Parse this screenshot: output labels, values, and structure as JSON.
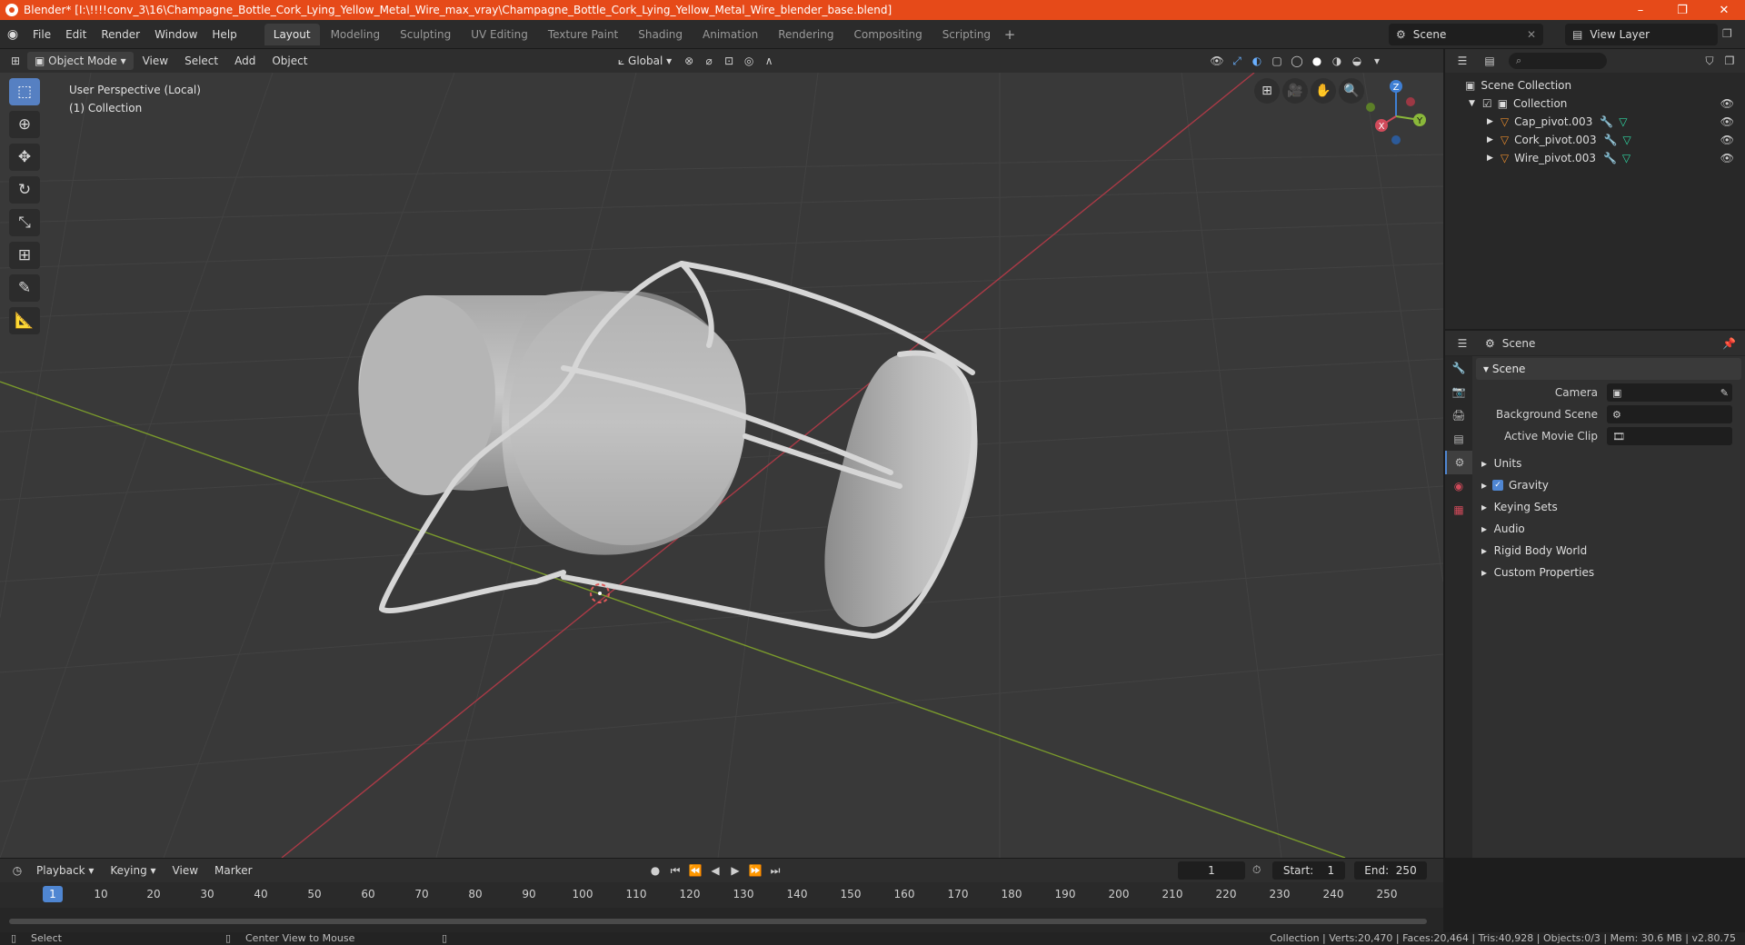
{
  "titlebar": {
    "title": "Blender* [I:\\!!!!conv_3\\16\\Champagne_Bottle_Cork_Lying_Yellow_Metal_Wire_max_vray\\Champagne_Bottle_Cork_Lying_Yellow_Metal_Wire_blender_base.blend]",
    "minimize": "–",
    "restore": "❐",
    "close": "✕"
  },
  "menu": [
    "File",
    "Edit",
    "Render",
    "Window",
    "Help"
  ],
  "workspaces": [
    "Layout",
    "Modeling",
    "Sculpting",
    "UV Editing",
    "Texture Paint",
    "Shading",
    "Animation",
    "Rendering",
    "Compositing",
    "Scripting"
  ],
  "active_workspace": "Layout",
  "scene_selector": {
    "value": "Scene"
  },
  "view_layer": {
    "value": "View Layer"
  },
  "viewport_header": {
    "mode": "Object Mode",
    "menus": [
      "View",
      "Select",
      "Add",
      "Object"
    ],
    "transform_orientation": "Global"
  },
  "viewport": {
    "perspective_label": "User Perspective (Local)",
    "collection_label": "(1) Collection",
    "gizmo": {
      "x": "X",
      "y": "Y",
      "z": "Z"
    }
  },
  "outliner": {
    "search_placeholder": "",
    "root": "Scene Collection",
    "collection": "Collection",
    "objects": [
      "Cap_pivot.003",
      "Cork_pivot.003",
      "Wire_pivot.003"
    ]
  },
  "properties": {
    "header_title": "Scene",
    "section": "Scene",
    "fields": [
      {
        "label": "Camera",
        "value": ""
      },
      {
        "label": "Background Scene",
        "value": ""
      },
      {
        "label": "Active Movie Clip",
        "value": ""
      }
    ],
    "subpanels": [
      "Units",
      "Gravity",
      "Keying Sets",
      "Audio",
      "Rigid Body World",
      "Custom Properties"
    ],
    "gravity_checked": true
  },
  "timeline": {
    "menus": [
      "Playback",
      "Keying",
      "View",
      "Marker"
    ],
    "current_frame": "1",
    "start_label": "Start:",
    "start": "1",
    "end_label": "End:",
    "end": "250",
    "ticks": [
      "1",
      "10",
      "20",
      "30",
      "40",
      "50",
      "60",
      "70",
      "80",
      "90",
      "100",
      "110",
      "120",
      "130",
      "140",
      "150",
      "160",
      "170",
      "180",
      "190",
      "200",
      "210",
      "220",
      "230",
      "240",
      "250"
    ]
  },
  "statusbar": {
    "left_action": "Select",
    "middle_action": "Center View to Mouse",
    "stats": "Collection | Verts:20,470 | Faces:20,464 | Tris:40,928 | Objects:0/3 | Mem: 30.6 MB | v2.80.75"
  },
  "colors": {
    "title_bar": "#e64a19",
    "accent_blue": "#4f86d2",
    "x_axis": "#d14a5a",
    "y_axis": "#8ab83a",
    "z_axis": "#3f7fd4"
  }
}
